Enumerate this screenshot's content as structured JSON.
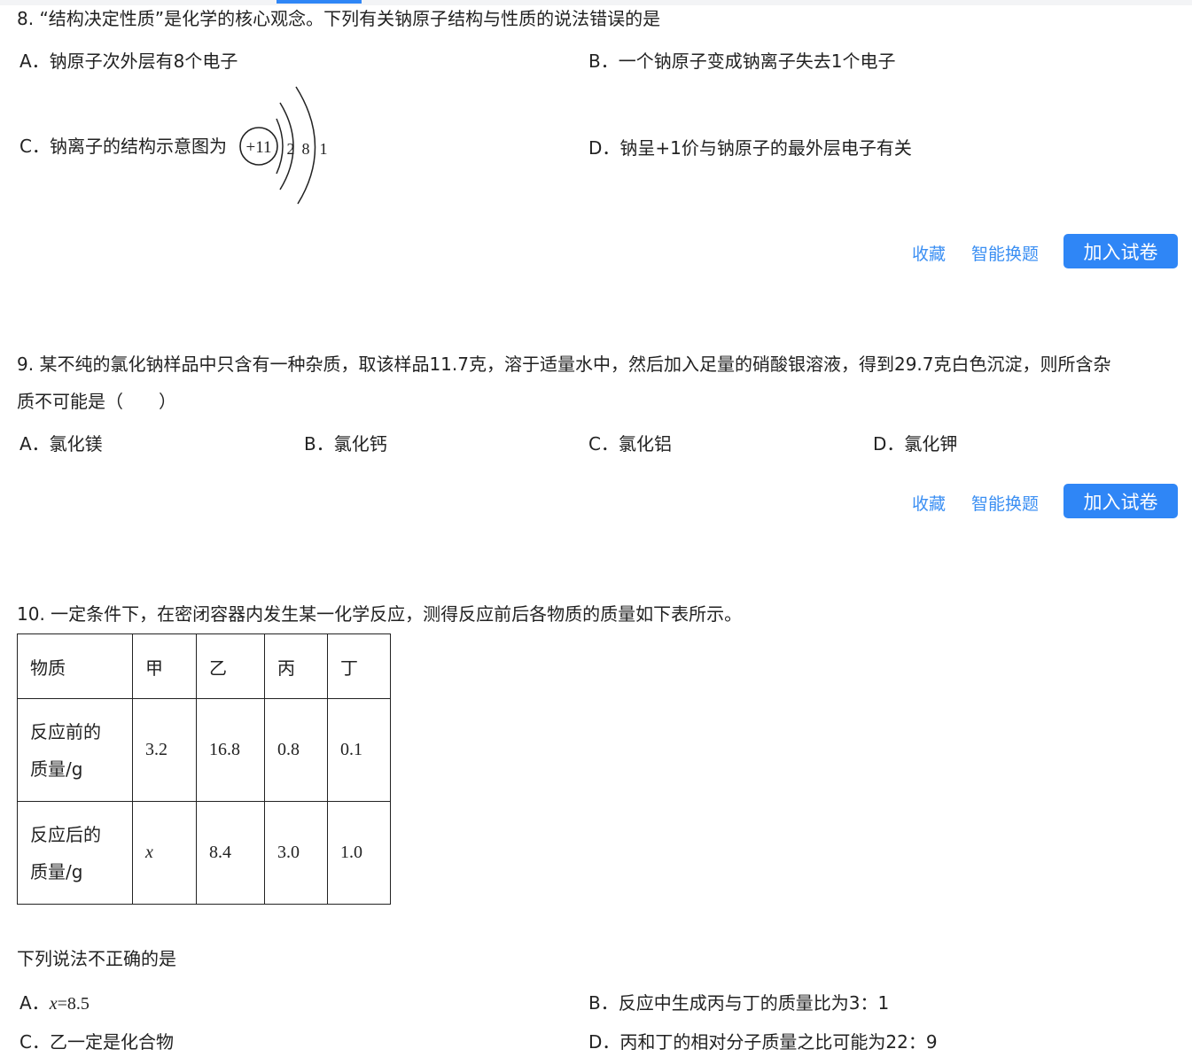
{
  "q8": {
    "stem": "8. “结构决定性质”是化学的核心观念。下列有关钠原子结构与性质的说法错误的是",
    "options": {
      "A": "A．钠原子次外层有8个电子",
      "B": "B．一个钠原子变成钠离子失去1个电子",
      "C": "C．钠离子的结构示意图为",
      "D": "D．钠呈+1价与钠原子的最外层电子有关"
    },
    "diagram": {
      "nucleus": "+11",
      "shells": [
        "2",
        "8",
        "1"
      ]
    }
  },
  "q9": {
    "stem_line1": "9. 某不纯的氯化钠样品中只含有一种杂质，取该样品11.7克，溶于适量水中，然后加入足量的硝酸银溶液，得到29.7克白色沉淀，则所含杂",
    "stem_line2": "质不可能是（　　）",
    "options": {
      "A": "A．氯化镁",
      "B": "B．氯化钙",
      "C": "C．氯化铝",
      "D": "D．氯化钾"
    }
  },
  "q10": {
    "stem": "10. 一定条件下，在密闭容器内发生某一化学反应，测得反应前后各物质的质量如下表所示。",
    "table": {
      "headers": [
        "物质",
        "甲",
        "乙",
        "丙",
        "丁"
      ],
      "row_before": {
        "label_line1": "反应前的",
        "label_line2": "质量/g",
        "values": [
          "3.2",
          "16.8",
          "0.8",
          "0.1"
        ]
      },
      "row_after": {
        "label_line1": "反应后的",
        "label_line2": "质量/g",
        "values": [
          "x",
          "8.4",
          "3.0",
          "1.0"
        ]
      }
    },
    "sub_stem": "下列说法不正确的是",
    "options": {
      "A_prefix": "A．",
      "A_var": "x",
      "A_rest": "=8.5",
      "B": "B．反应中生成丙与丁的质量比为3：1",
      "C": "C．乙一定是化合物",
      "D": "D．丙和丁的相对分子质量之比可能为22：9"
    }
  },
  "actions": {
    "favorite": "收藏",
    "smart_swap": "智能换题",
    "add_to_paper": "加入试卷"
  },
  "colors": {
    "accent": "#2f86f6",
    "link": "#3b8ff3",
    "text": "#222222"
  }
}
